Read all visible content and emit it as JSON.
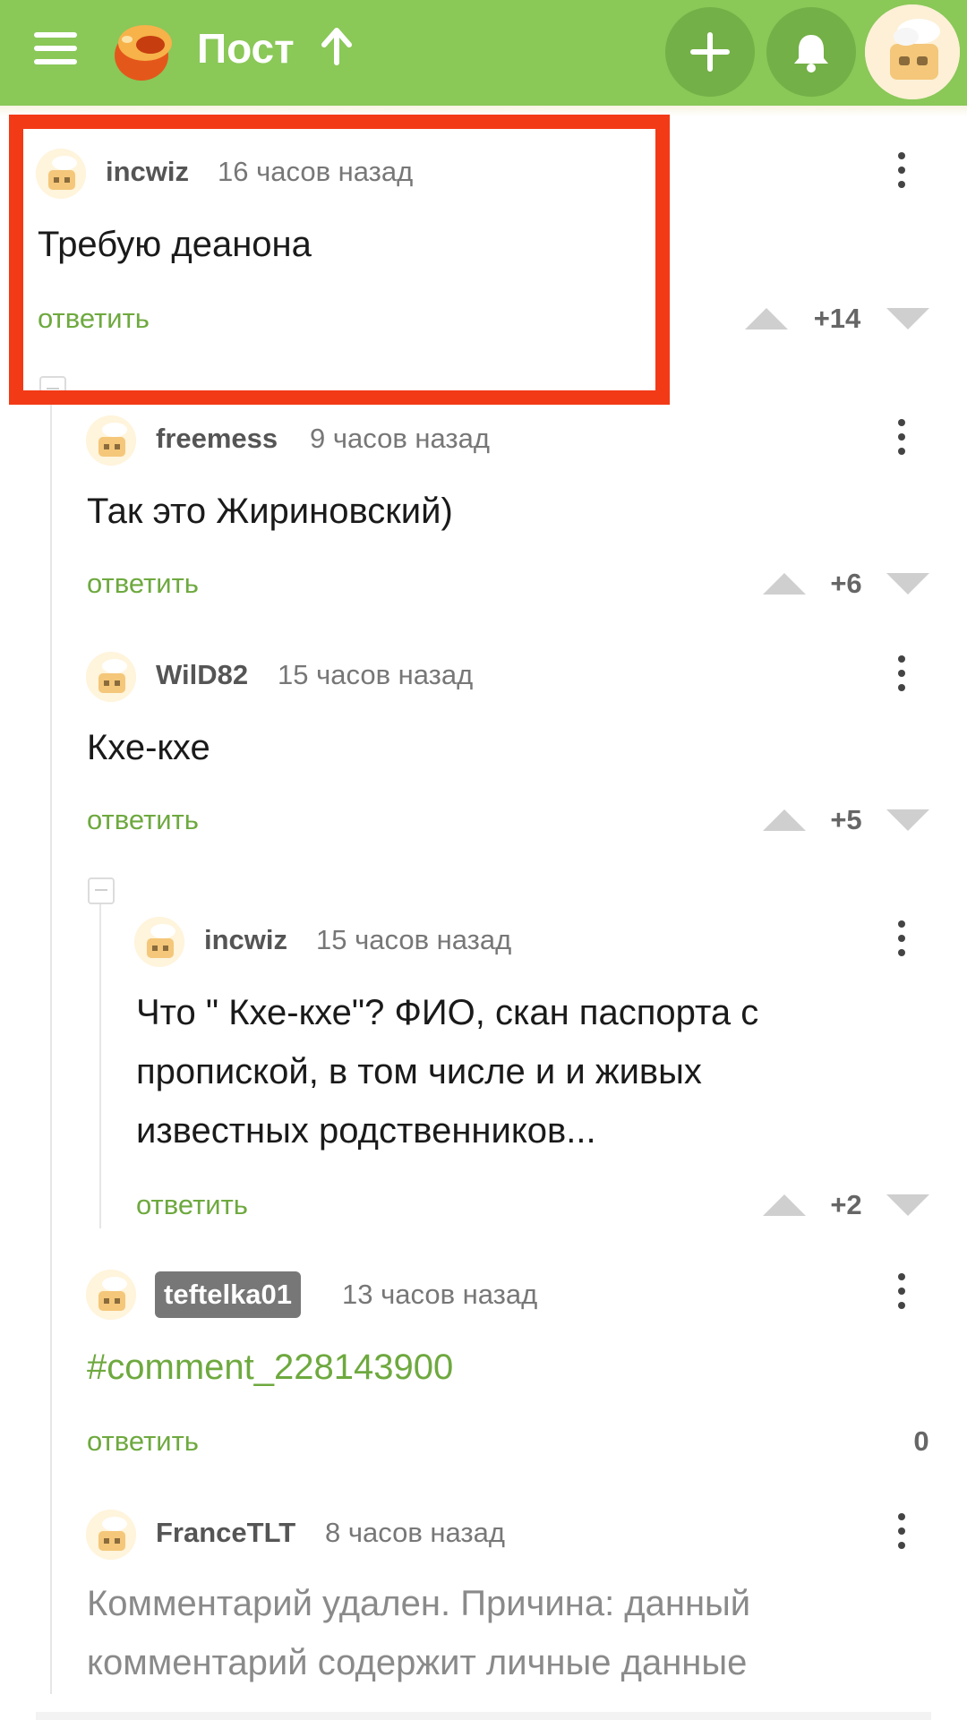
{
  "header": {
    "title": "Пост",
    "menu_icon": "hamburger-icon",
    "logo_icon": "pikabu-logo",
    "sort_icon": "arrow-up-icon",
    "add_icon": "plus-icon",
    "notifications_icon": "bell-icon",
    "profile_icon": "user-avatar"
  },
  "colors": {
    "header_bg": "#8ac858",
    "header_button": "#73b047",
    "accent_green": "#6ea93f",
    "highlight_red": "#f33a17"
  },
  "comments": [
    {
      "author": "incwiz",
      "time": "16 часов назад",
      "text": "Требую деанона",
      "reply": "ответить",
      "rating": "+14"
    },
    {
      "author": "freemess",
      "time": "9 часов назад",
      "text": "Так это Жириновский)",
      "reply": "ответить",
      "rating": "+6"
    },
    {
      "author": "WilD82",
      "time": "15 часов назад",
      "text": "Кхе-кхе",
      "reply": "ответить",
      "rating": "+5"
    },
    {
      "author": "incwiz",
      "time": "15 часов назад",
      "text_lines": [
        "Что \" Кхе-кхе\"? ФИО, скан паспорта с",
        "пропиской, в том числе и и живых",
        "известных родственников..."
      ],
      "reply": "ответить",
      "rating": "+2"
    },
    {
      "author": "teftelka01",
      "time": "13 часов назад",
      "text": "#comment_228143900",
      "reply": "ответить",
      "rating": "0"
    },
    {
      "author": "FranceTLT",
      "time": "8 часов назад",
      "text_lines": [
        "Комментарий удален. Причина: данный",
        "комментарий содержит личные данные"
      ]
    }
  ]
}
